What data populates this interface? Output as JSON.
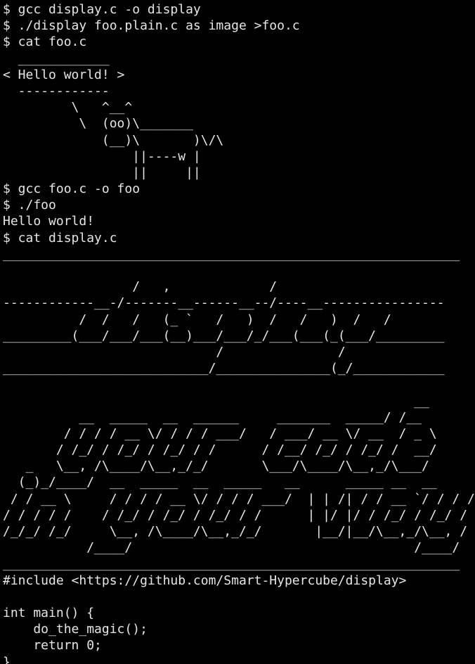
{
  "terminal": {
    "lines": [
      "$ gcc display.c -o display",
      "$ ./display foo.plain.c as image >foo.c",
      "$ cat foo.c",
      "  ____________",
      "< Hello world! >",
      "  ------------",
      "         \\   ^__^",
      "          \\  (oo)\\_______",
      "             (__)\\       )\\/\\",
      "                 ||----w |",
      "                 ||     ||",
      "$ gcc foo.c -o foo",
      "$ ./foo",
      "Hello world!",
      "$ cat display.c",
      "____________________________________________________________",
      "",
      "                 /   ,             /",
      "------------__-/-------__------__--/----__----------------",
      "          /  /   /   (_ `   /   )  /   /   )  /   /",
      "_________(___/___/___(__)___/___/_/___(___(_(___/_________",
      "                            /               /",
      "___________________________/_______________(_/____________",
      "",
      "                                                      __",
      "          __  _____  __  ______     _______  _____/ /__",
      "        / / / / __ \\/ / / / ___/   / ___/ __ \\/ __  / _ \\",
      "       / /_/ / /_/ / /_/ / /      / /__/ /_/ / /_/ /  __/",
      "   _   \\__, /\\____/\\__,_/_/       \\___/\\____/\\__,_/\\___/",
      "  (_)_/____/  __  _____  __  _____   __      _____ __  __",
      " / / __ \\     / / / / __ \\/ / / / ___/  | | /| / / __ `/ / / /",
      "/ / / / /    / /_/ / /_/ / /_/ / /      | |/ |/ / /_/ / /_/ /",
      "/_/_/ /_/     \\__, /\\____/\\__,_/_/       |__/|__/\\__,_/\\__, /",
      "           /____/                                     /____/",
      "____________________________________________________________",
      "#include <https://github.com/Smart-Hypercube/display>",
      "",
      "int main() {",
      "    do_the_magic();",
      "    return 0;",
      "}"
    ],
    "prompt": "$"
  },
  "colors": {
    "background": "#000000",
    "foreground": "#e6e6e6"
  }
}
